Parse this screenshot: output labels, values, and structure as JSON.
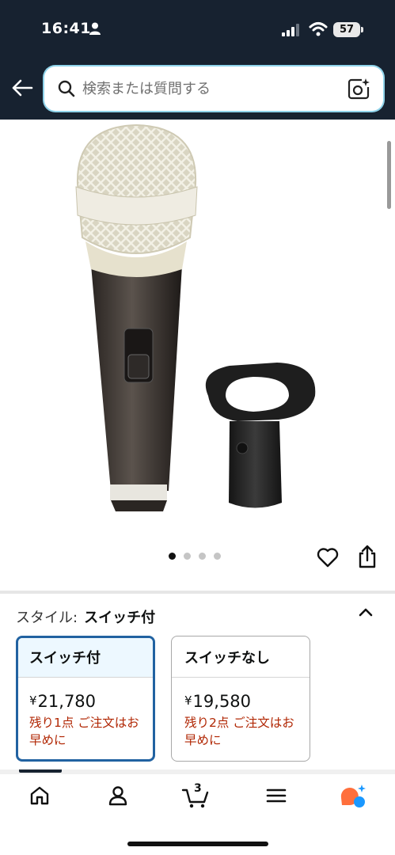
{
  "status": {
    "time": "16:41",
    "battery": "57"
  },
  "search": {
    "placeholder": "検索または質問する"
  },
  "gallery": {
    "image_count": 4,
    "active_index": 0
  },
  "style": {
    "label": "スタイル:",
    "selected": "スイッチ付",
    "options": [
      {
        "name": "スイッチ付",
        "currency": "¥",
        "price": "21,780",
        "stock": "残り1点 ご注文はお早めに",
        "selected": true
      },
      {
        "name": "スイッチなし",
        "currency": "¥",
        "price": "19,580",
        "stock": "残り2点 ご注文はお早めに",
        "selected": false
      }
    ]
  },
  "nav": {
    "cart_count": "3"
  },
  "colors": {
    "header_bg": "#172230",
    "selected_border": "#2162a1",
    "stock_text": "#b12704",
    "alexa": "#ff6f3c"
  }
}
